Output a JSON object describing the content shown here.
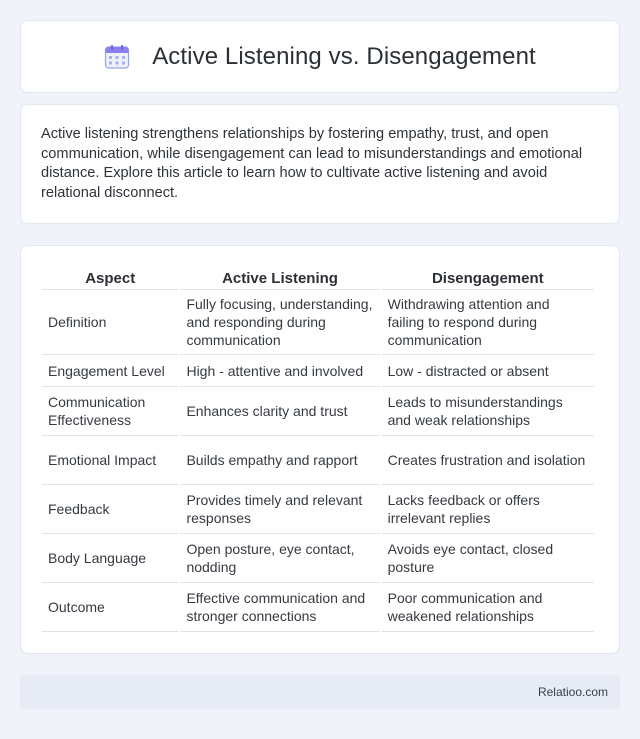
{
  "header": {
    "title": "Active Listening vs. Disengagement",
    "icon": "calendar-icon"
  },
  "intro": {
    "text": "Active listening strengthens relationships by fostering empathy, trust, and open communication, while disengagement can lead to misunderstandings and emotional distance. Explore this article to learn how to cultivate active listening and avoid relational disconnect."
  },
  "table": {
    "headers": [
      "Aspect",
      "Active Listening",
      "Disengagement"
    ],
    "rows": [
      [
        "Definition",
        "Fully focusing, understanding, and responding during communication",
        "Withdrawing attention and failing to respond during communication"
      ],
      [
        "Engagement Level",
        "High - attentive and involved",
        "Low - distracted or absent"
      ],
      [
        "Communication Effectiveness",
        "Enhances clarity and trust",
        "Leads to misunderstandings and weak relationships"
      ],
      [
        "Emotional Impact",
        "Builds empathy and rapport",
        "Creates frustration and isolation"
      ],
      [
        "Feedback",
        "Provides timely and relevant responses",
        "Lacks feedback or offers irrelevant replies"
      ],
      [
        "Body Language",
        "Open posture, eye contact, nodding",
        "Avoids eye contact, closed posture"
      ],
      [
        "Outcome",
        "Effective communication and stronger connections",
        "Poor communication and weakened relationships"
      ]
    ]
  },
  "footer": {
    "brand": "Relatioo.com"
  },
  "colors": {
    "background": "#f0f3f9",
    "card": "#ffffff",
    "footer_bg": "#e6ebf5",
    "icon_accent": "#8a7ef0"
  }
}
